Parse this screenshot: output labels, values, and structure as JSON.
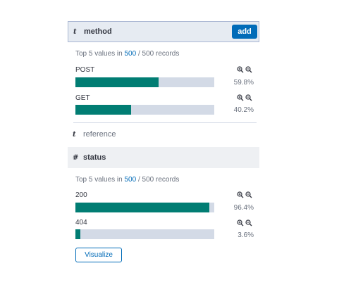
{
  "method_field": {
    "type_glyph": "t",
    "name": "method",
    "add_label": "add",
    "summary": {
      "prefix": "Top 5 values in ",
      "shown": "500",
      "sep": " / ",
      "total": "500",
      "suffix": " records"
    },
    "values": [
      {
        "label": "POST",
        "percent_text": "59.8%",
        "fraction": 0.598
      },
      {
        "label": "GET",
        "percent_text": "40.2%",
        "fraction": 0.402
      }
    ]
  },
  "reference_field": {
    "type_glyph": "t",
    "name": "reference"
  },
  "status_field": {
    "type_glyph": "#",
    "name": "status",
    "summary": {
      "prefix": "Top 5 values in ",
      "shown": "500",
      "sep": " / ",
      "total": "500",
      "suffix": " records"
    },
    "values": [
      {
        "label": "200",
        "percent_text": "96.4%",
        "fraction": 0.964
      },
      {
        "label": "404",
        "percent_text": "3.6%",
        "fraction": 0.036
      }
    ],
    "visualize_label": "Visualize"
  },
  "icons": {
    "zoom_in": "magnify-plus-icon",
    "zoom_out": "magnify-minus-icon"
  },
  "colors": {
    "accent": "#006bb8",
    "bar_fill": "#017d73",
    "bar_track": "#d3dae6"
  }
}
